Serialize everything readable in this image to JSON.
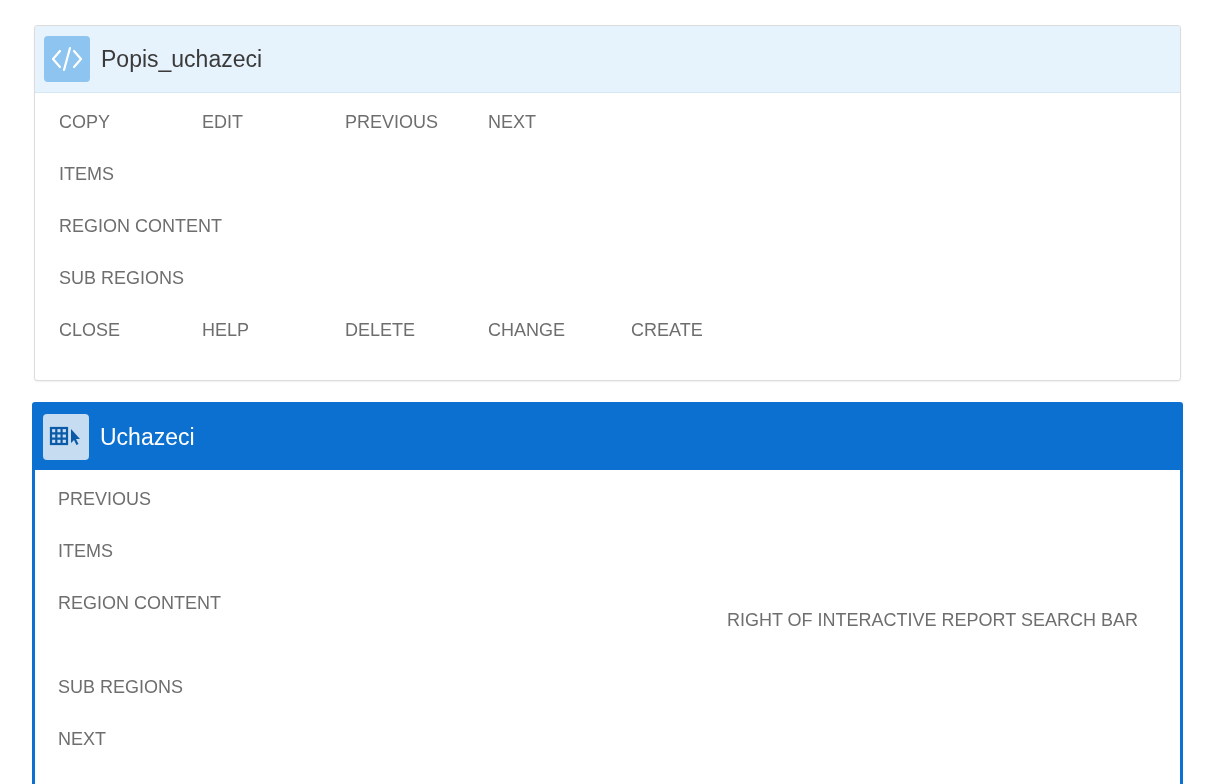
{
  "regions": [
    {
      "title": "Popis_uchazeci",
      "kind": "code",
      "selected": false,
      "rows": [
        {
          "slots": [
            "COPY",
            "EDIT",
            "PREVIOUS",
            "NEXT"
          ]
        },
        {
          "slots": [
            "ITEMS"
          ]
        },
        {
          "slots": [
            "REGION CONTENT"
          ]
        },
        {
          "slots": [
            "SUB REGIONS"
          ]
        },
        {
          "slots": [
            "CLOSE",
            "HELP",
            "DELETE",
            "CHANGE",
            "CREATE"
          ]
        }
      ]
    },
    {
      "title": "Uchazeci",
      "kind": "report",
      "selected": true,
      "rows": [
        {
          "slots": [
            "PREVIOUS"
          ]
        },
        {
          "slots": [
            "ITEMS"
          ]
        },
        {
          "slots": [
            "REGION CONTENT"
          ],
          "right": "RIGHT OF INTERACTIVE REPORT SEARCH BAR"
        },
        {
          "slots": [
            "SUB REGIONS"
          ]
        },
        {
          "slots": [
            "NEXT"
          ]
        }
      ]
    }
  ]
}
